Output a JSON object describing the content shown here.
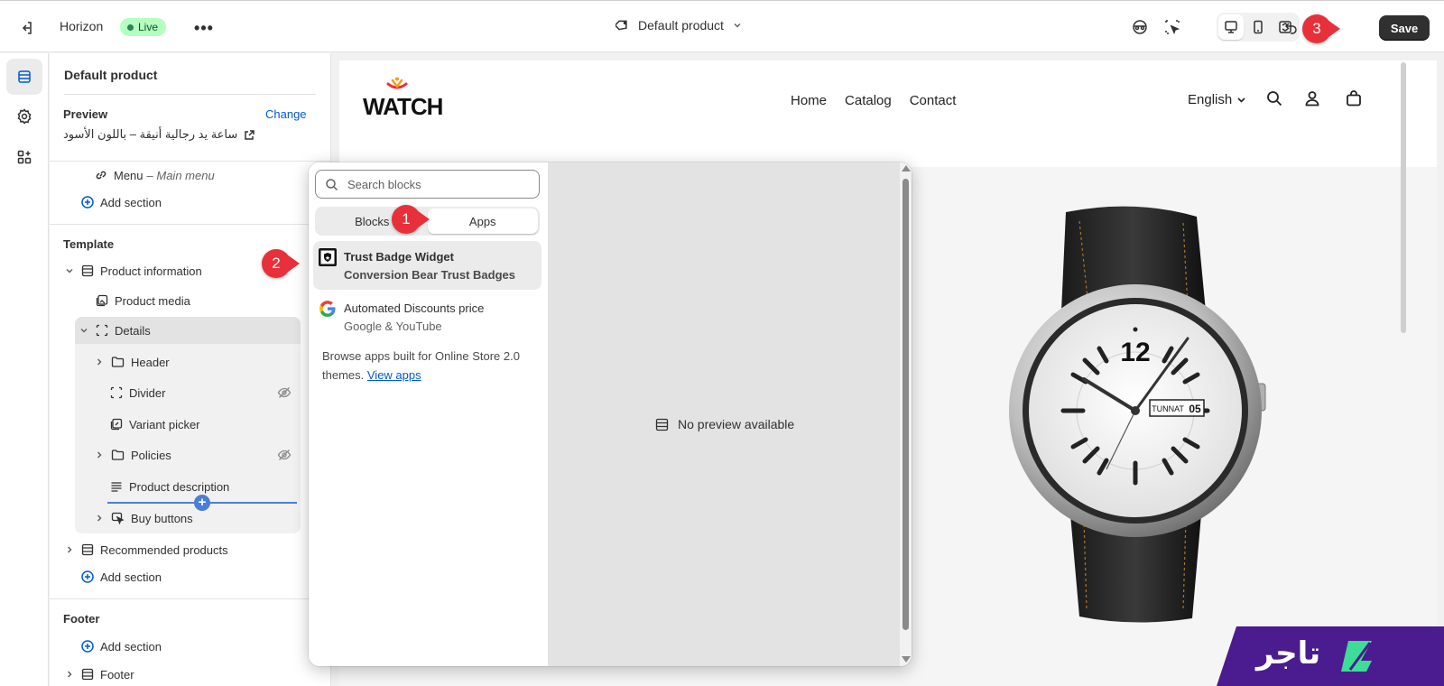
{
  "topbar": {
    "theme_name": "Horizon",
    "live_badge": "Live",
    "more": "•••",
    "template": "Default product",
    "save": "Save"
  },
  "callouts": [
    "1",
    "2",
    "3"
  ],
  "rail": {
    "items": [
      "sections-icon",
      "settings-icon",
      "apps-icon"
    ]
  },
  "sidebar": {
    "title": "Default product",
    "preview_label": "Preview",
    "change_link": "Change",
    "preview_product": "ساعة يد رجالية أنيقة – باللون الأسود",
    "menu_item": "Menu",
    "menu_sub": "– Main menu",
    "add_section": "Add section",
    "template_label": "Template",
    "tree": {
      "product_information": "Product information",
      "product_media": "Product media",
      "details": "Details",
      "header": "Header",
      "divider": "Divider",
      "variant_picker": "Variant picker",
      "policies": "Policies",
      "product_description": "Product description",
      "buy_buttons": "Buy buttons"
    },
    "recommended_products": "Recommended products",
    "add_section_2": "Add section",
    "footer_label": "Footer",
    "add_section_3": "Add section",
    "footer_item": "Footer"
  },
  "popover": {
    "search_placeholder": "Search blocks",
    "tabs": [
      "Blocks",
      "Apps"
    ],
    "active_tab": "Apps",
    "apps": [
      {
        "name": "Trust Badge Widget",
        "vendor": "Conversion Bear Trust Badges"
      },
      {
        "name": "Automated Discounts price",
        "vendor": "Google & YouTube"
      }
    ],
    "browse_text": "Browse apps built for Online Store 2.0 themes.",
    "browse_link": "View apps",
    "no_preview": "No preview available"
  },
  "store": {
    "logo_text": "WATCH",
    "nav": [
      "Home",
      "Catalog",
      "Contact"
    ],
    "language": "English",
    "watch_dial_number": "12",
    "watch_day": "TUNNAT",
    "watch_date": "05"
  },
  "brand_watermark": "تاجر",
  "colors": {
    "accent": "#005bd3",
    "save_bg": "#303030",
    "callout": "#e8303a",
    "live_bg": "#b4fec0",
    "brand_purple": "#4b1c8f"
  }
}
